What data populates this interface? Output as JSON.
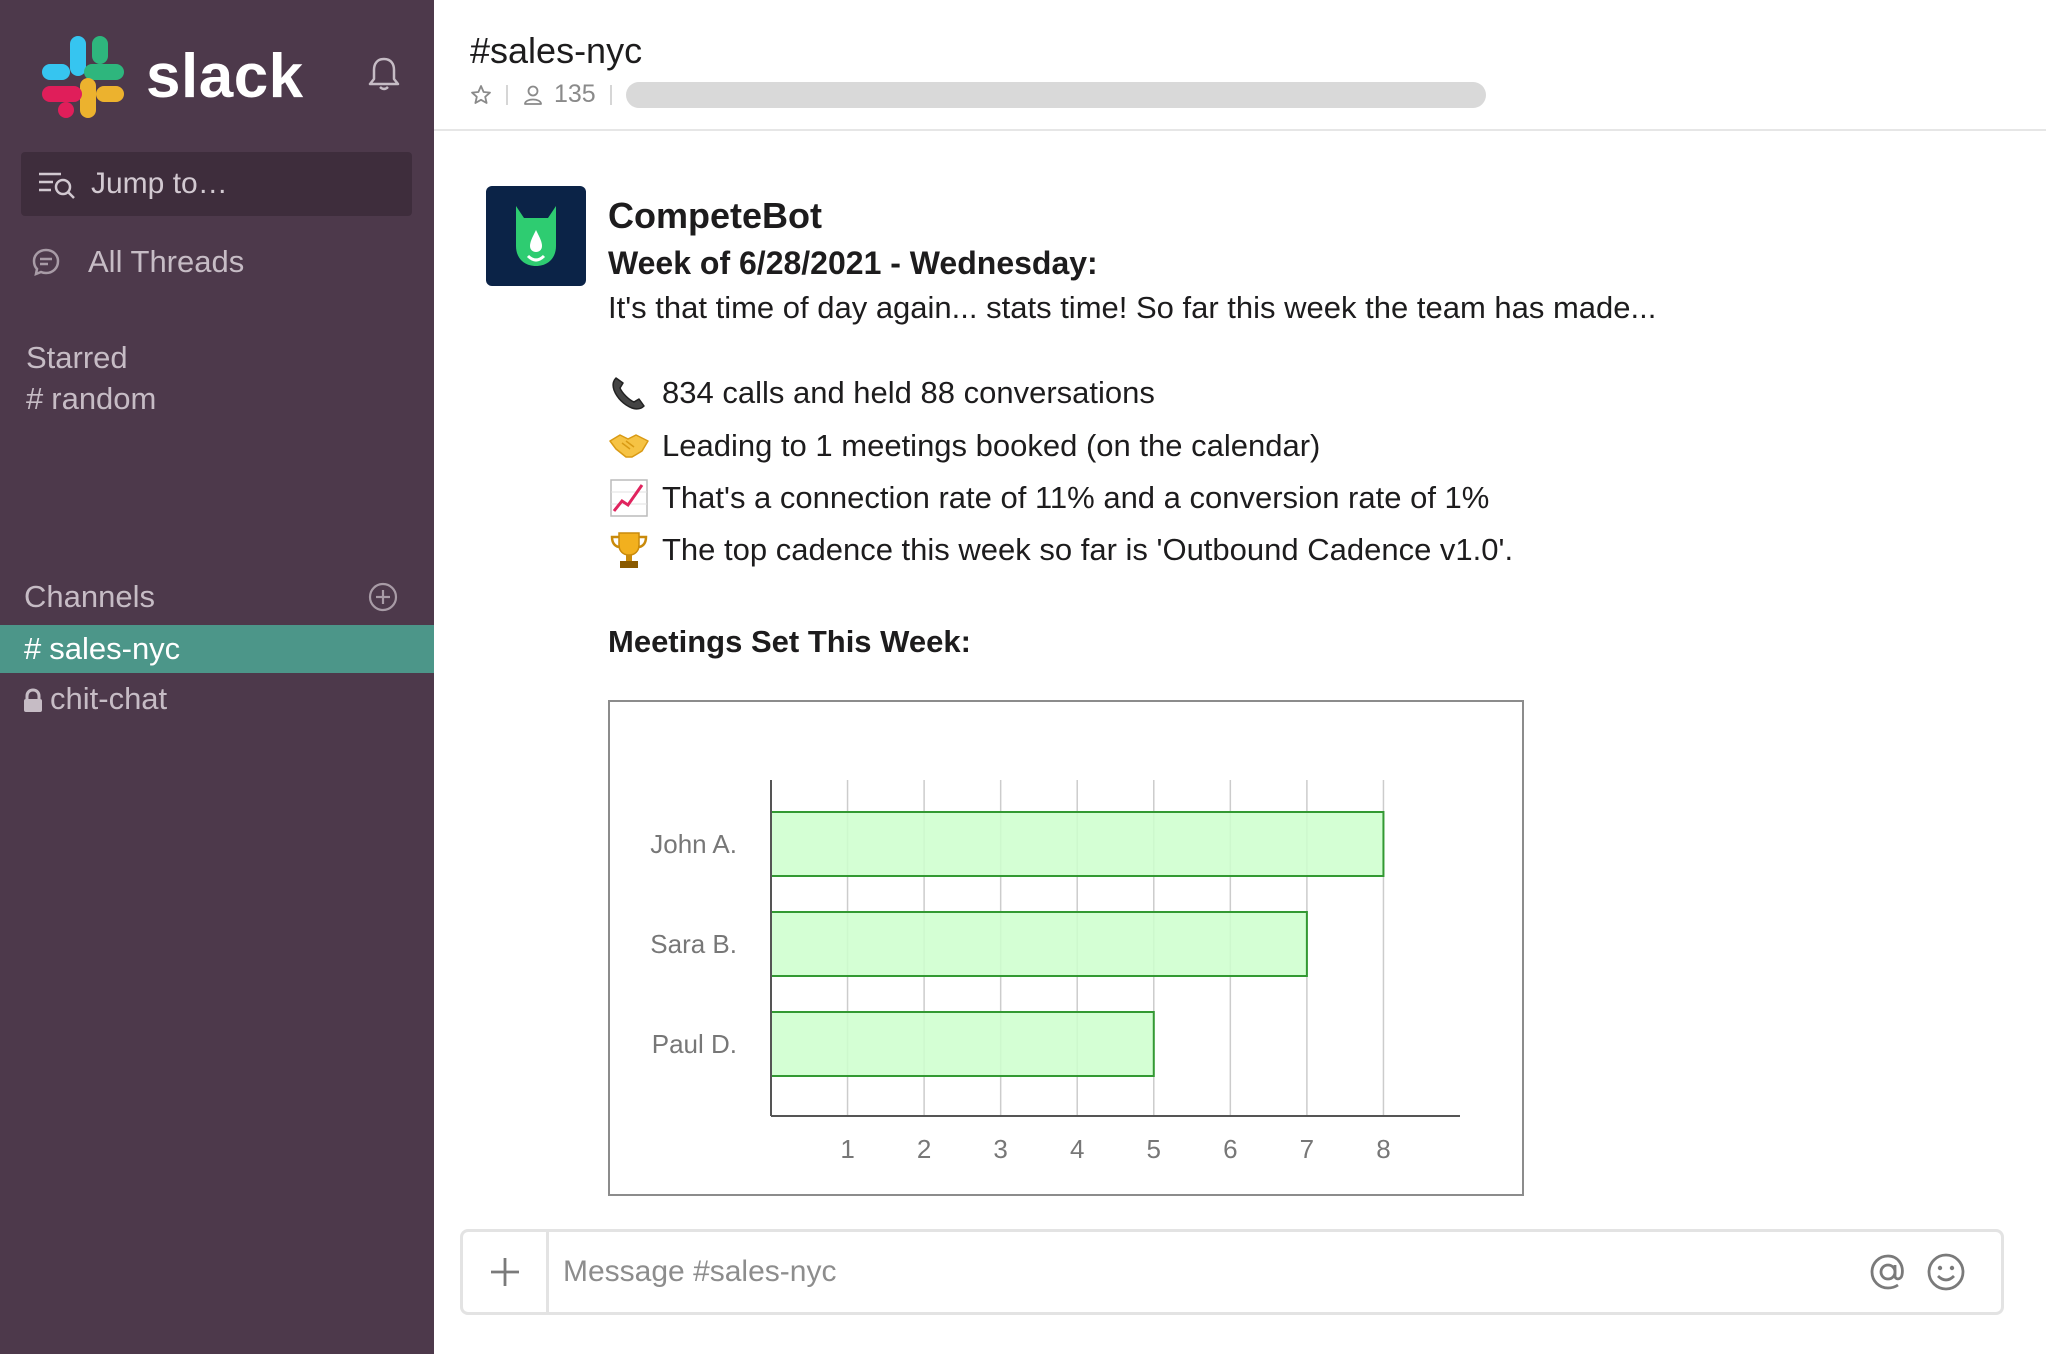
{
  "sidebar": {
    "brand": "slack",
    "jump_to": "Jump to…",
    "all_threads": "All Threads",
    "starred_heading": "Starred",
    "starred_items": [
      {
        "label": "random"
      }
    ],
    "channels_heading": "Channels",
    "channels": [
      {
        "label": "sales-nyc",
        "active": true,
        "private": false
      },
      {
        "label": "chit-chat",
        "active": false,
        "private": true
      }
    ],
    "colors": {
      "background": "#4d394b",
      "active_channel": "#4c9689"
    }
  },
  "header": {
    "channel_title": "#sales-nyc",
    "member_count": "135"
  },
  "message": {
    "sender": "CompeteBot",
    "week_line": "Week of 6/28/2021 - Wednesday:",
    "intro": "It's that time of day again... stats time! So far this week the team has made...",
    "stats": [
      {
        "icon": "telephone-icon",
        "text": "834 calls and held 88 conversations"
      },
      {
        "icon": "handshake-icon",
        "text": "Leading to 1 meetings booked (on the calendar)"
      },
      {
        "icon": "chart-increasing-icon",
        "text": "That's a connection rate of 11% and a conversion rate of 1%"
      },
      {
        "icon": "trophy-icon",
        "text": "The top cadence this week so far is 'Outbound Cadence v1.0'."
      }
    ],
    "chart_heading": "Meetings Set This Week:"
  },
  "chart_data": {
    "type": "bar",
    "orientation": "horizontal",
    "categories": [
      "John A.",
      "Sara B.",
      "Paul D."
    ],
    "values": [
      8,
      7,
      5
    ],
    "xticks": [
      1,
      2,
      3,
      4,
      5,
      6,
      7,
      8
    ],
    "xlim": [
      0,
      9
    ],
    "title": "",
    "xlabel": "",
    "ylabel": "",
    "grid": true,
    "bar_fill": "#ccffcc",
    "bar_stroke": "#339933"
  },
  "composer": {
    "placeholder": "Message #sales-nyc"
  }
}
